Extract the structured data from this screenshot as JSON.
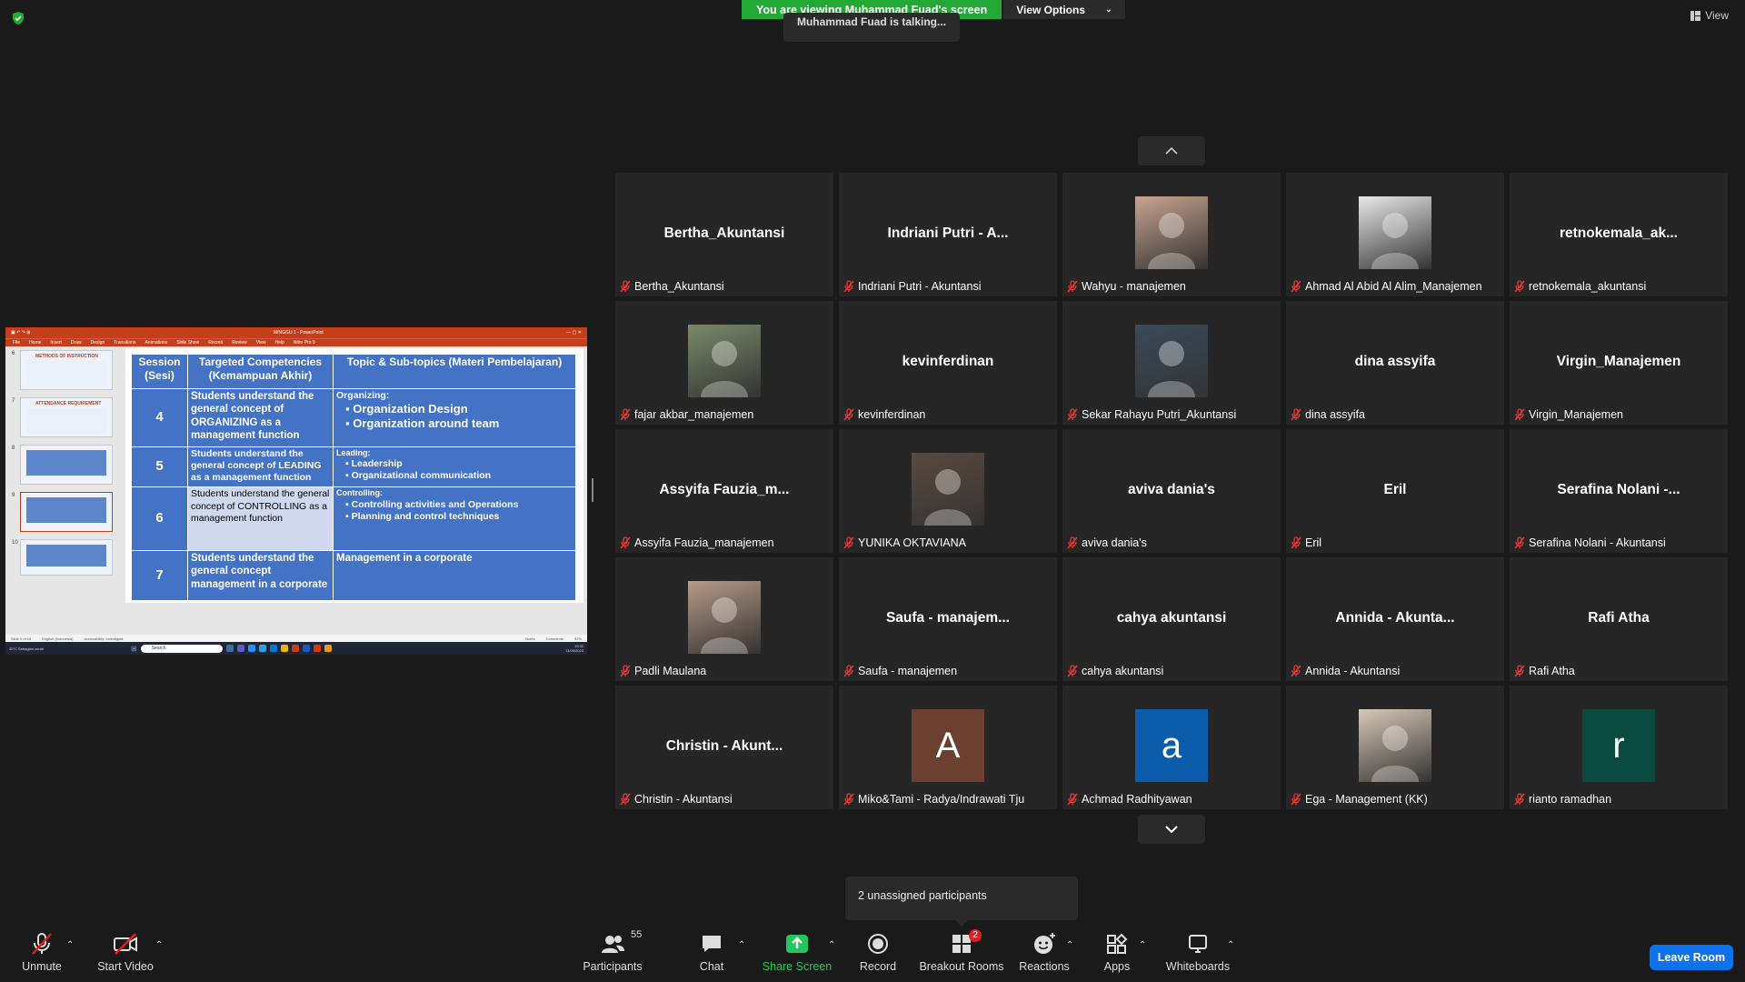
{
  "banner": {
    "viewing_text": "You are viewing Muhammad Fuad's screen",
    "view_options": "View Options",
    "talking": "Muhammad Fuad is talking...",
    "view_label": "View"
  },
  "presentation": {
    "app_title": "MINGGU 1 - PowerPoint",
    "ribbon_tabs": [
      "File",
      "Home",
      "Insert",
      "Draw",
      "Design",
      "Transitions",
      "Animations",
      "Slide Show",
      "Record",
      "Review",
      "View",
      "Help",
      "Nitro Pro 9"
    ],
    "thumbnails": [
      {
        "num": "6",
        "title": "METHODS OF INSTRUCTION"
      },
      {
        "num": "7",
        "title": "ATTENDANCE REQUIREMENT"
      },
      {
        "num": "8",
        "title": ""
      },
      {
        "num": "9",
        "title": ""
      },
      {
        "num": "10",
        "title": ""
      }
    ],
    "table": {
      "header": {
        "session": "Session (Sesi)",
        "competencies": "Targeted Competencies (Kemampuan Akhir)",
        "topic": "Topic & Sub-topics (Materi Pembelajaran)"
      },
      "rows": [
        {
          "session": "4",
          "competency": "Students understand the general concept of ORGANIZING as a management function",
          "topic_head": "Organizing:",
          "topic_items": [
            "Organization Design",
            "Organization around team"
          ]
        },
        {
          "session": "5",
          "competency": "Students understand the general concept of LEADING as a management function",
          "topic_head": "Leading:",
          "topic_items": [
            "Leadership",
            "Organizational communication"
          ]
        },
        {
          "session": "6",
          "competency": "Students understand the general concept of CONTROLLING as a management function",
          "topic_head": "Controlling:",
          "topic_items": [
            "Controlling activities and Operations",
            "Planning and control techniques"
          ]
        },
        {
          "session": "7",
          "competency": "Students understand the general concept management in a corporate",
          "topic_head": "Management in a corporate",
          "topic_items": []
        }
      ]
    },
    "status": {
      "slide": "Slide 9 of 16",
      "language": "English (Indonesia)",
      "accessibility": "Accessibility: Investigate",
      "notes": "Notes",
      "comments": "Comments",
      "zoom": "92%"
    },
    "taskbar": {
      "weather": "30°C Sebagian cerah",
      "search": "Search",
      "time": "19:32",
      "date": "11/09/2023"
    }
  },
  "participants_tiles": [
    {
      "display": "Bertha_Akuntansi",
      "label": "Bertha_Akuntansi",
      "kind": "name"
    },
    {
      "display": "Indriani Putri - A...",
      "label": "Indriani Putri - Akuntansi",
      "kind": "name"
    },
    {
      "display": "",
      "label": "Wahyu - manajemen",
      "kind": "photo",
      "color": "#c9a48f"
    },
    {
      "display": "",
      "label": "Ahmad Al Abid Al Alim_Manajemen",
      "kind": "photo",
      "color": "#e8e8e8"
    },
    {
      "display": "retnokemala_ak...",
      "label": "retnokemala_akuntansi",
      "kind": "name"
    },
    {
      "display": "",
      "label": "fajar akbar_manajemen",
      "kind": "photo",
      "color": "#7a8a6a"
    },
    {
      "display": "kevinferdinan",
      "label": "kevinferdinan",
      "kind": "name"
    },
    {
      "display": "",
      "label": "Sekar Rahayu Putri_Akuntansi",
      "kind": "photo",
      "color": "#3a4a5a"
    },
    {
      "display": "dina assyifa",
      "label": "dina assyifa",
      "kind": "name"
    },
    {
      "display": "Virgin_Manajemen",
      "label": "Virgin_Manajemen",
      "kind": "name"
    },
    {
      "display": "Assyifa  Fauzia_m...",
      "label": "Assyifa Fauzia_manajemen",
      "kind": "name"
    },
    {
      "display": "",
      "label": "YUNIKA OKTAVIANA",
      "kind": "photo",
      "color": "#5a4a40"
    },
    {
      "display": "aviva dania's",
      "label": "aviva dania's",
      "kind": "name"
    },
    {
      "display": "Eril",
      "label": "Eril",
      "kind": "name"
    },
    {
      "display": "Serafina Nolani -...",
      "label": "Serafina Nolani - Akuntansi",
      "kind": "name"
    },
    {
      "display": "",
      "label": "Padli Maulana",
      "kind": "photo",
      "color": "#b89a88"
    },
    {
      "display": "Saufa  -  manajem...",
      "label": "Saufa - manajemen",
      "kind": "name"
    },
    {
      "display": "cahya akuntansi",
      "label": "cahya akuntansi",
      "kind": "name"
    },
    {
      "display": "Annida  -  Akunta...",
      "label": "Annida - Akuntansi",
      "kind": "name"
    },
    {
      "display": "Rafi Atha",
      "label": "Rafi Atha",
      "kind": "name"
    },
    {
      "display": "Christin  -  Akunt...",
      "label": "Christin  - Akuntansi",
      "kind": "name"
    },
    {
      "display": "A",
      "label": "Miko&Tami - Radya/Indrawati Tju",
      "kind": "letter",
      "color": "#6b4030"
    },
    {
      "display": "a",
      "label": "Achmad Radhityawan",
      "kind": "letter",
      "color": "#0b5cab"
    },
    {
      "display": "",
      "label": "Ega - Management (KK)",
      "kind": "photo",
      "color": "#d8c8b8"
    },
    {
      "display": "r",
      "label": "rianto ramadhan",
      "kind": "letter",
      "color": "#0b4a3e"
    }
  ],
  "popover": {
    "unassigned": "2 unassigned participants"
  },
  "toolbar": {
    "unmute": "Unmute",
    "start_video": "Start Video",
    "participants": "Participants",
    "participants_count": "55",
    "chat": "Chat",
    "share_screen": "Share Screen",
    "record": "Record",
    "breakout_rooms": "Breakout Rooms",
    "breakout_badge": "2",
    "reactions": "Reactions",
    "apps": "Apps",
    "whiteboards": "Whiteboards",
    "leave_room": "Leave Room"
  }
}
